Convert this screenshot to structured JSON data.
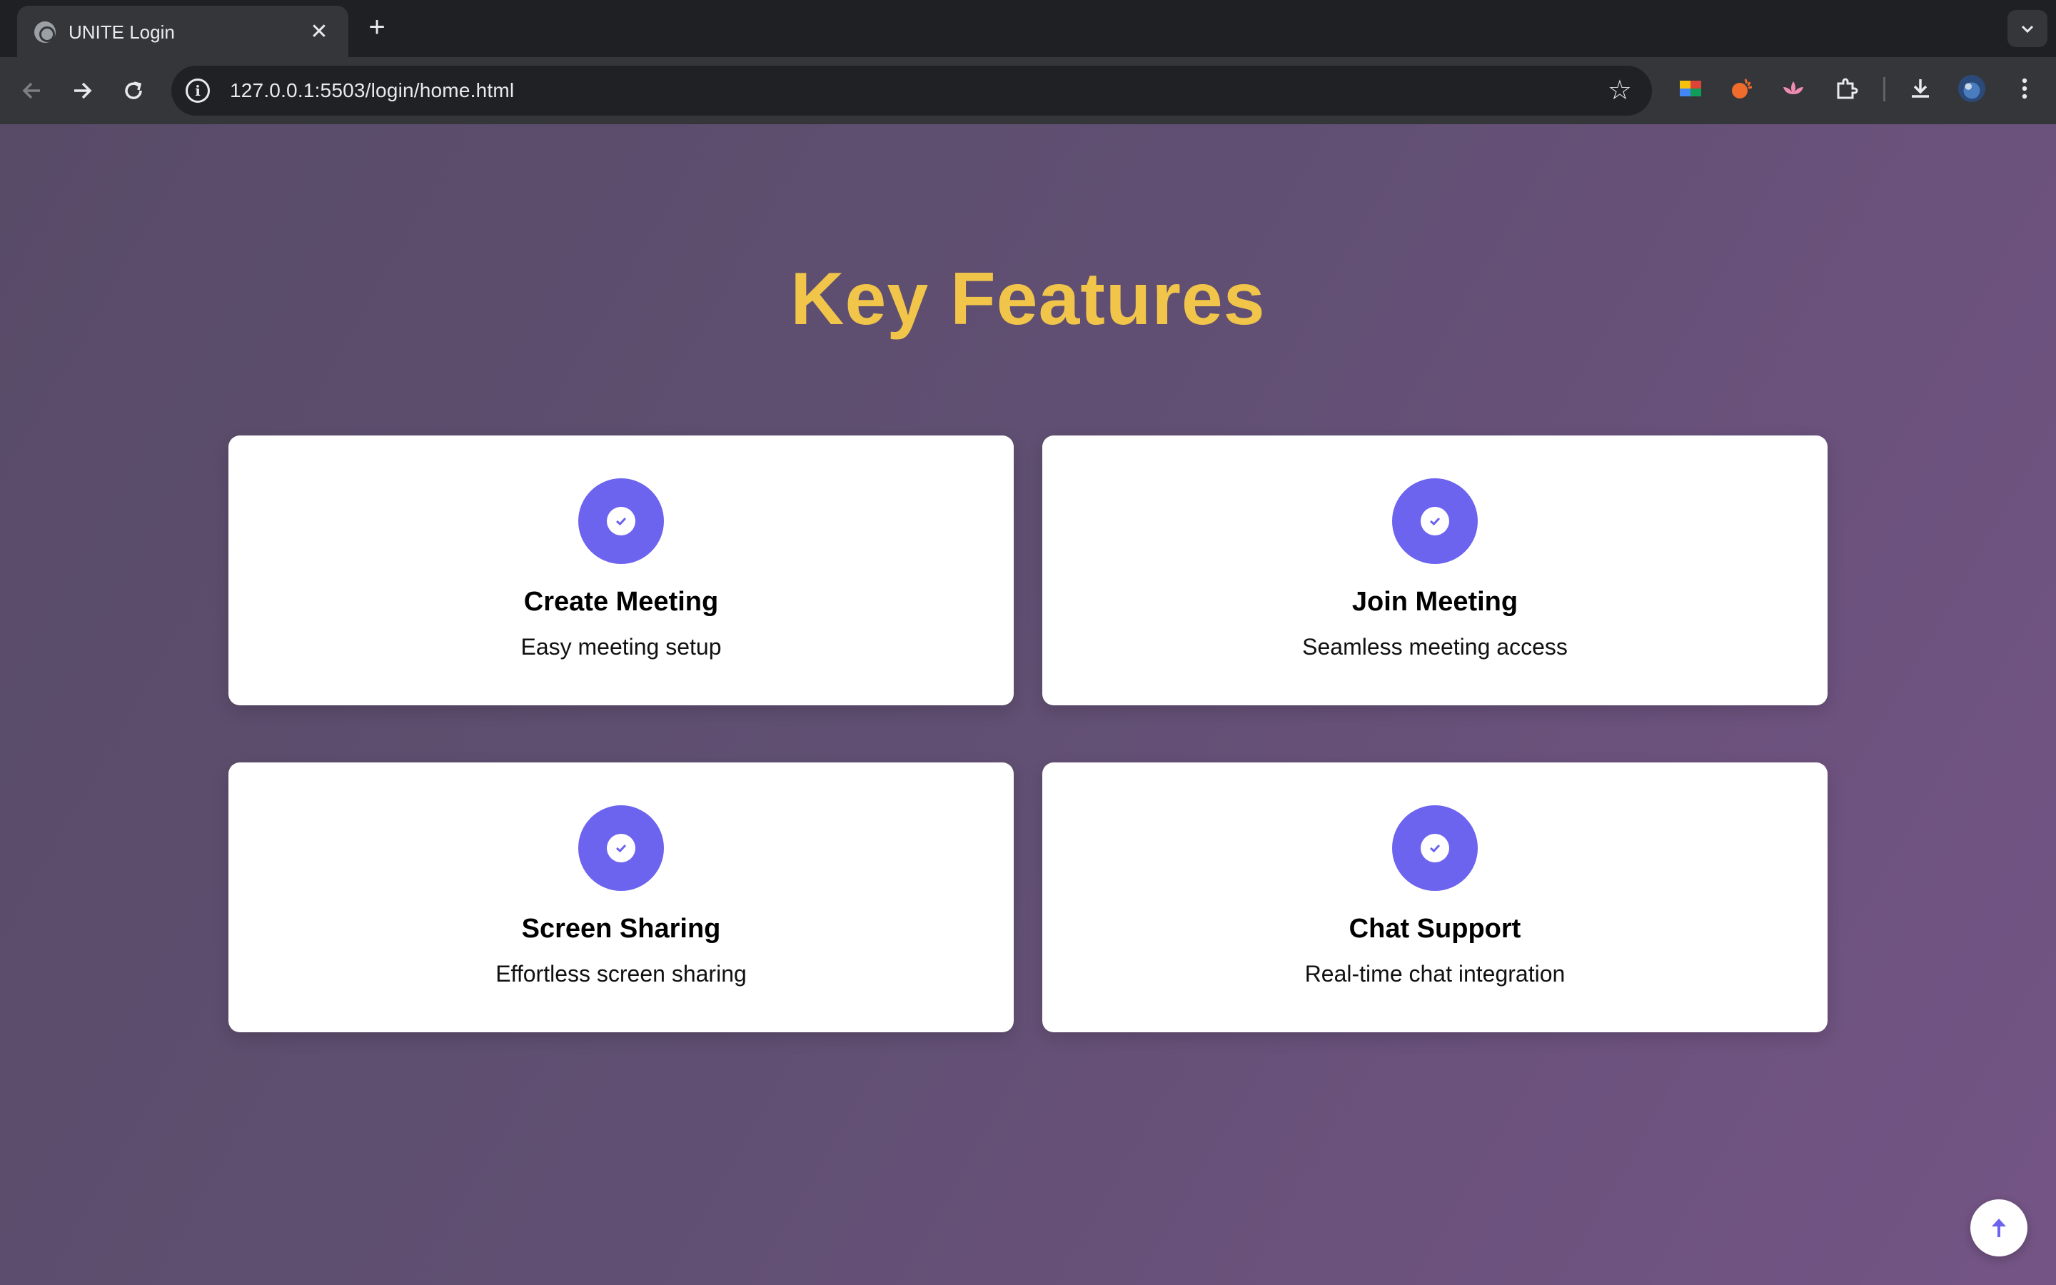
{
  "browser": {
    "tab": {
      "title": "UNITE Login",
      "favicon": "globe-icon"
    },
    "address_bar": {
      "url": "127.0.0.1:5503/login/home.html"
    }
  },
  "colors": {
    "heading": "#f1c54a",
    "accent": "#6c63ef",
    "card_bg": "#ffffff"
  },
  "page": {
    "title": "Key Features",
    "features": [
      {
        "title": "Create Meeting",
        "description": "Easy meeting setup",
        "icon": "check-icon"
      },
      {
        "title": "Join Meeting",
        "description": "Seamless meeting access",
        "icon": "check-icon"
      },
      {
        "title": "Screen Sharing",
        "description": "Effortless screen sharing",
        "icon": "check-icon"
      },
      {
        "title": "Chat Support",
        "description": "Real-time chat integration",
        "icon": "check-icon"
      }
    ],
    "scroll_top_icon": "arrow-up-icon"
  }
}
